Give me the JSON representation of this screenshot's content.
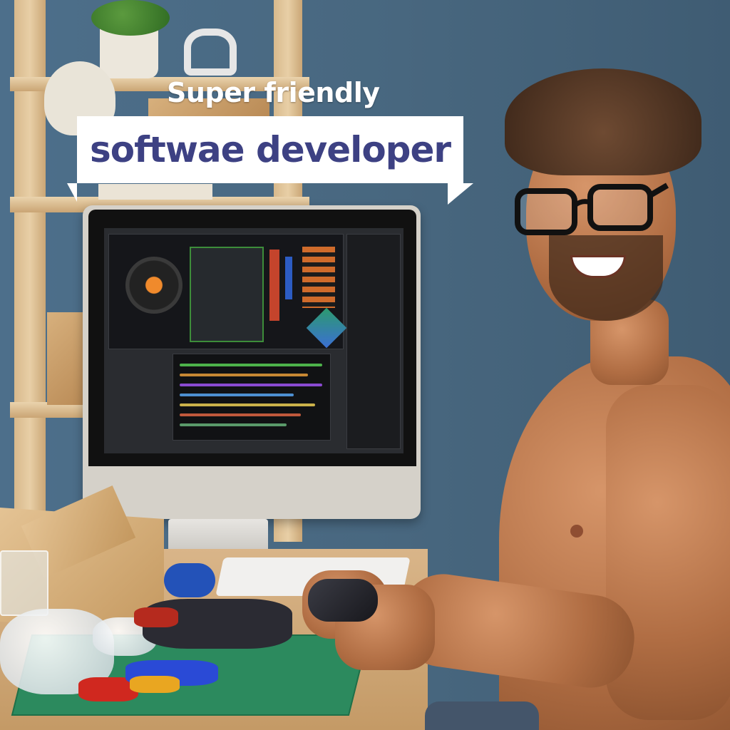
{
  "overlay": {
    "headline": "Super friendly",
    "banner": "softwae developer"
  },
  "colors": {
    "wall": "#476a85",
    "banner_text": "#3d4183",
    "banner_bg": "#ffffff",
    "headline_text": "#ffffff"
  },
  "scene": {
    "subjects": [
      "person-with-glasses",
      "monitor",
      "desk",
      "shelf",
      "controller",
      "cutting-mat"
    ]
  }
}
